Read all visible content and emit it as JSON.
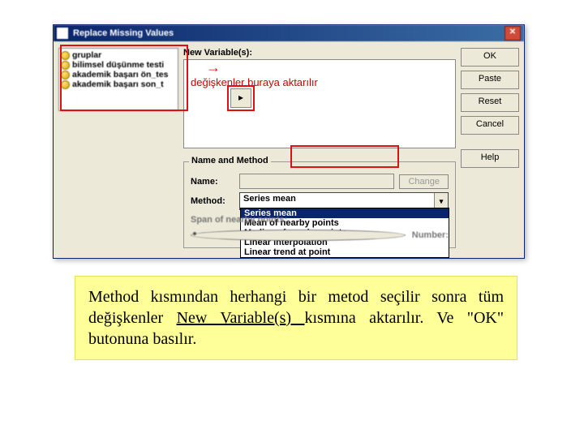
{
  "dialog": {
    "title": "Replace Missing Values",
    "vars": [
      "gruplar",
      "bilimsel düşünme testi",
      "akademik başarı ön_tes",
      "akademik başarı son_t"
    ],
    "newvar_label": "New Variable(s):",
    "target_hint": "değişkenler buraya aktarılır",
    "xfer_glyph": "▸",
    "group": {
      "legend": "Name and Method",
      "name_label": "Name:",
      "change_label": "Change",
      "method_label": "Method:",
      "method_value": "Series mean",
      "options": [
        "Series mean",
        "Mean of nearby points",
        "Median of nearby points",
        "Linear interpolation",
        "Linear trend at point"
      ],
      "span_label": "Span of nearby points:",
      "numb_label": "Number:"
    },
    "buttons": {
      "ok": "OK",
      "paste": "Paste",
      "reset": "Reset",
      "cancel": "Cancel",
      "help": "Help"
    }
  },
  "note": {
    "p1a": "Method kısmından herhangi bir metod seçilir sonra tüm değişkenler ",
    "p1u": "New Variable(s) ",
    "p1b": "kısmına aktarılır. Ve \"OK\" butonuna basılır."
  }
}
